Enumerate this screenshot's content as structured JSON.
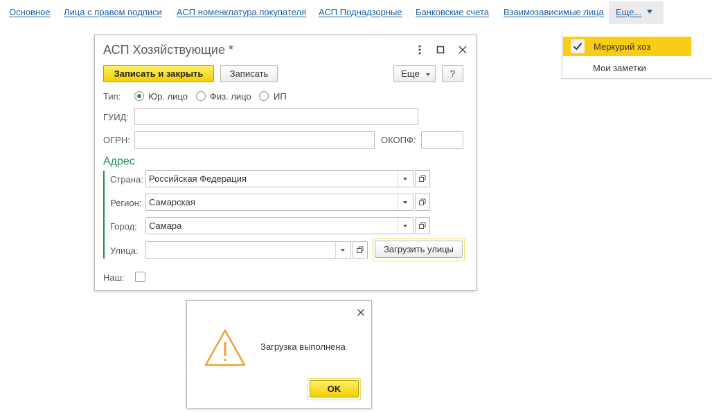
{
  "nav": {
    "links": [
      "Основное",
      "Лица с правом подписи",
      "АСП номенклатура покупателя",
      "АСП Поднадзорные",
      "Банковские счета",
      "Взаимозависимые лица"
    ],
    "more_label": "Еще..."
  },
  "more_menu": {
    "items": [
      {
        "label": "Меркурий хоз",
        "checked": true
      },
      {
        "label": "Мои заметки",
        "checked": false
      }
    ]
  },
  "form": {
    "title": "АСП Хозяйствующие *",
    "toolbar": {
      "save_close_label": "Записать и закрыть",
      "save_label": "Записать",
      "more_label": "Еще",
      "help_label": "?"
    },
    "type": {
      "label": "Тип:",
      "options": [
        "Юр. лицо",
        "Физ. лицо",
        "ИП"
      ],
      "selected": "Юр. лицо"
    },
    "guid": {
      "label": "ГУИД:",
      "value": ""
    },
    "ogrn": {
      "label": "ОГРН:",
      "value": ""
    },
    "okopf": {
      "label": "ОКОПФ:",
      "value": ""
    },
    "address": {
      "title": "Адрес",
      "country": {
        "label": "Страна:",
        "value": "Российская Федерация"
      },
      "region": {
        "label": "Регион:",
        "value": "Самарская"
      },
      "city": {
        "label": "Город:",
        "value": "Самара"
      },
      "street": {
        "label": "Улица:",
        "value": ""
      },
      "load_streets_label": "Загрузить улицы"
    },
    "ours": {
      "label": "Наш:",
      "checked": false
    }
  },
  "message": {
    "text": "Загрузка выполнена",
    "ok_label": "OK"
  },
  "colors": {
    "link": "#1d5fa6",
    "accent_yellow": "#fbcc16",
    "section_green": "#18904a",
    "warning_orange": "#f0a030"
  }
}
